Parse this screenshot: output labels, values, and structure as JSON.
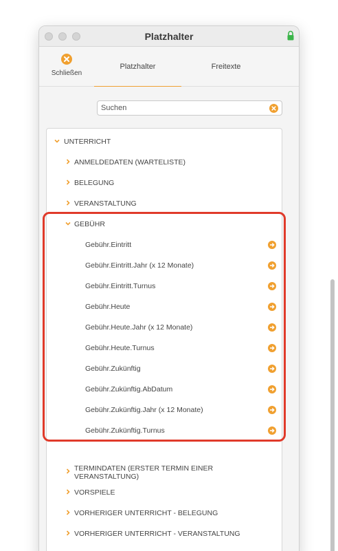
{
  "window": {
    "title": "Platzhalter"
  },
  "toolbar": {
    "close_label": "Schließen",
    "tabs": [
      {
        "label": "Platzhalter",
        "active": true
      },
      {
        "label": "Freitexte",
        "active": false
      }
    ]
  },
  "search": {
    "placeholder": "Suchen",
    "value": ""
  },
  "tree": {
    "root": {
      "label": "UNTERRICHT",
      "expanded": true
    },
    "groups_before": [
      {
        "label": "ANMELDEDATEN (WARTELISTE)"
      },
      {
        "label": "BELEGUNG"
      },
      {
        "label": "VERANSTALTUNG"
      }
    ],
    "expanded_group": {
      "label": "GEBÜHR",
      "items": [
        "Gebühr.Eintritt",
        "Gebühr.Eintritt.Jahr (x 12 Monate)",
        "Gebühr.Eintritt.Turnus",
        "Gebühr.Heute",
        "Gebühr.Heute.Jahr (x 12 Monate)",
        "Gebühr.Heute.Turnus",
        "Gebühr.Zukünftig",
        "Gebühr.Zukünftig.AbDatum",
        "Gebühr.Zukünftig.Jahr (x 12 Monate)",
        "Gebühr.Zukünftig.Turnus"
      ]
    },
    "groups_after": [
      {
        "label": "TERMINDATEN (ERSTER TERMIN EINER VERANSTALTUNG)"
      },
      {
        "label": "VORSPIELE"
      },
      {
        "label": "VORHERIGER UNTERRICHT - BELEGUNG"
      },
      {
        "label": "VORHERIGER UNTERRICHT - VERANSTALTUNG"
      }
    ]
  },
  "colors": {
    "accent": "#f0a030",
    "highlight": "#e03a2a"
  }
}
